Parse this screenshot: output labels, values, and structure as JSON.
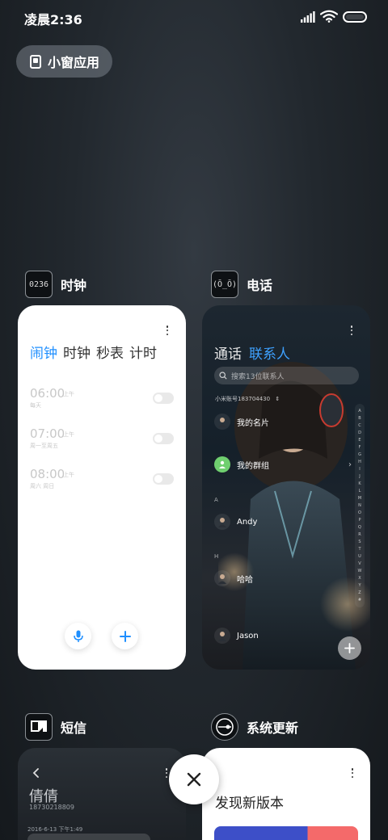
{
  "status_bar": {
    "time": "凌晨2:36"
  },
  "mini_window": {
    "label": "小窗应用"
  },
  "apps": {
    "clock": {
      "name": "时钟",
      "icon_text": "0236",
      "tabs": [
        "闹钟",
        "时钟",
        "秒表",
        "计时"
      ],
      "active_tab": "闹钟",
      "alarms": [
        {
          "time": "06:00",
          "ampm": "上午",
          "repeat": "每天",
          "enabled": false
        },
        {
          "time": "07:00",
          "ampm": "上午",
          "repeat": "周一至周五",
          "enabled": false
        },
        {
          "time": "08:00",
          "ampm": "上午",
          "repeat": "周六 周日",
          "enabled": false
        }
      ]
    },
    "phone": {
      "name": "电话",
      "icon_text": "(Ō_Ō)",
      "tabs": [
        "通话",
        "联系人"
      ],
      "active_tab": "联系人",
      "search_placeholder": "搜索13位联系人",
      "account": "小米账号183704430",
      "contacts": [
        {
          "name": "我的名片"
        },
        {
          "name": "我的群组"
        },
        {
          "section": "A",
          "name": "Andy"
        },
        {
          "section": "H",
          "name": "哈哈"
        },
        {
          "name": "Jason"
        }
      ],
      "index_letters": [
        "A",
        "B",
        "C",
        "D",
        "E",
        "F",
        "G",
        "H",
        "I",
        "J",
        "K",
        "L",
        "M",
        "N",
        "O",
        "P",
        "Q",
        "R",
        "S",
        "T",
        "U",
        "V",
        "W",
        "X",
        "Y",
        "Z",
        "#"
      ]
    },
    "sms": {
      "name": "短信",
      "contact_name": "倩倩",
      "contact_number": "18730218809",
      "date": "2016-6-13 下午1:49"
    },
    "update": {
      "name": "系统更新",
      "title": "发现新版本"
    }
  },
  "colors": {
    "accent": "#1f8fff",
    "phone_accent": "#3ea1ff",
    "group_green": "#6fcf6f"
  }
}
